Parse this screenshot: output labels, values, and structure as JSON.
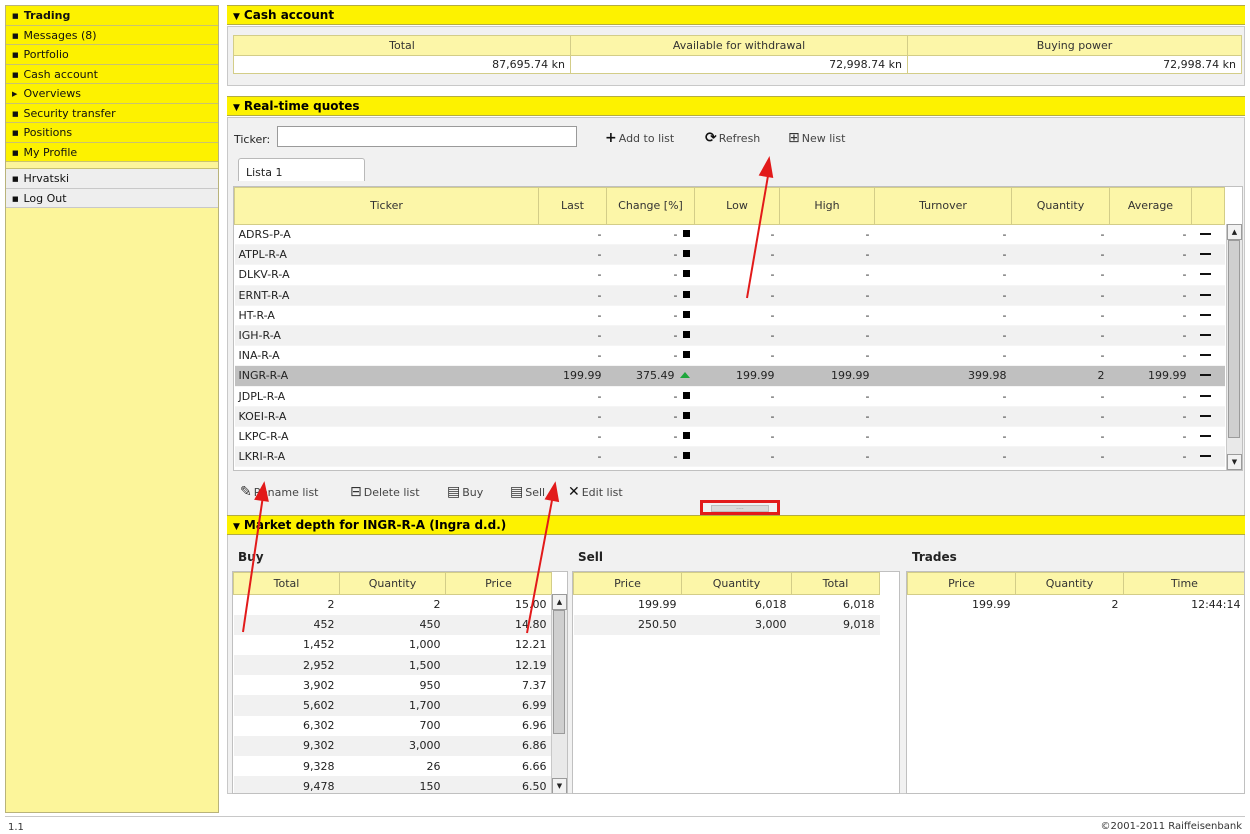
{
  "sidebar": {
    "items": [
      {
        "label": "Trading",
        "active": true
      },
      {
        "label": "Messages (8)"
      },
      {
        "label": "Portfolio"
      },
      {
        "label": "Cash account"
      },
      {
        "label": "Overviews"
      },
      {
        "label": "Security transfer"
      },
      {
        "label": "Positions"
      },
      {
        "label": "My Profile"
      }
    ],
    "secondary": [
      "Hrvatski",
      "Log Out"
    ]
  },
  "cash": {
    "title": "Cash account",
    "headers": [
      "Total",
      "Available for withdrawal",
      "Buying power"
    ],
    "values": [
      "87,695.74 kn",
      "72,998.74 kn",
      "72,998.74 kn"
    ]
  },
  "quotes": {
    "title": "Real-time quotes",
    "ticker_label": "Ticker:",
    "ticker_value": "",
    "add_label": "Add to list",
    "refresh_label": "Refresh",
    "newlist_label": "New list",
    "tab_label": "Lista 1",
    "headers": [
      "Ticker",
      "Last",
      "Change [%]",
      "Low",
      "High",
      "Turnover",
      "Quantity",
      "Average"
    ],
    "rows": [
      [
        "ADRS-P-A",
        "-",
        "-",
        "-",
        "-",
        "-",
        "-",
        "-"
      ],
      [
        "ATPL-R-A",
        "-",
        "-",
        "-",
        "-",
        "-",
        "-",
        "-"
      ],
      [
        "DLKV-R-A",
        "-",
        "-",
        "-",
        "-",
        "-",
        "-",
        "-"
      ],
      [
        "ERNT-R-A",
        "-",
        "-",
        "-",
        "-",
        "-",
        "-",
        "-"
      ],
      [
        "HT-R-A",
        "-",
        "-",
        "-",
        "-",
        "-",
        "-",
        "-"
      ],
      [
        "IGH-R-A",
        "-",
        "-",
        "-",
        "-",
        "-",
        "-",
        "-"
      ],
      [
        "INA-R-A",
        "-",
        "-",
        "-",
        "-",
        "-",
        "-",
        "-"
      ],
      [
        "INGR-R-A",
        "199.99",
        "375.49",
        "199.99",
        "199.99",
        "399.98",
        "2",
        "199.99"
      ],
      [
        "JDPL-R-A",
        "-",
        "-",
        "-",
        "-",
        "-",
        "-",
        "-"
      ],
      [
        "KOEI-R-A",
        "-",
        "-",
        "-",
        "-",
        "-",
        "-",
        "-"
      ],
      [
        "LKPC-R-A",
        "-",
        "-",
        "-",
        "-",
        "-",
        "-",
        "-"
      ],
      [
        "LKRI-R-A",
        "-",
        "-",
        "-",
        "-",
        "-",
        "-",
        "-"
      ]
    ],
    "selected_row": 7,
    "actions": {
      "rename": "Rename list",
      "delete": "Delete list",
      "buy": "Buy",
      "sell": "Sell",
      "edit": "Edit list"
    }
  },
  "depth": {
    "title": "Market depth for INGR-R-A (Ingra d.d.)",
    "buy": {
      "label": "Buy",
      "headers": [
        "Total",
        "Quantity",
        "Price"
      ],
      "rows": [
        [
          "2",
          "2",
          "15.00"
        ],
        [
          "452",
          "450",
          "14.80"
        ],
        [
          "1,452",
          "1,000",
          "12.21"
        ],
        [
          "2,952",
          "1,500",
          "12.19"
        ],
        [
          "3,902",
          "950",
          "7.37"
        ],
        [
          "5,602",
          "1,700",
          "6.99"
        ],
        [
          "6,302",
          "700",
          "6.96"
        ],
        [
          "9,302",
          "3,000",
          "6.86"
        ],
        [
          "9,328",
          "26",
          "6.66"
        ],
        [
          "9,478",
          "150",
          "6.50"
        ]
      ]
    },
    "sell": {
      "label": "Sell",
      "headers": [
        "Price",
        "Quantity",
        "Total"
      ],
      "rows": [
        [
          "199.99",
          "6,018",
          "6,018"
        ],
        [
          "250.50",
          "3,000",
          "9,018"
        ]
      ]
    },
    "trades": {
      "label": "Trades",
      "headers": [
        "Price",
        "Quantity",
        "Time"
      ],
      "rows": [
        [
          "199.99",
          "2",
          "12:44:14"
        ]
      ]
    }
  },
  "splitter_grip": "....",
  "footer": {
    "version": "1.1",
    "copyright": "©2001-2011 Raiffeisenbank"
  },
  "colors": {
    "accent_yellow": "#fdf200",
    "sidebar_bg": "#fcf59a",
    "annotation_red": "#e21a1a",
    "up_green": "#1ea63c"
  },
  "icons": [
    "nav-bullet-icon",
    "triangle-right-icon",
    "plus-icon",
    "refresh-icon",
    "new-list-icon",
    "rename-icon",
    "delete-icon",
    "buy-icon",
    "sell-icon",
    "edit-icon",
    "minus-icon",
    "status-square-icon",
    "up-arrow-icon"
  ]
}
